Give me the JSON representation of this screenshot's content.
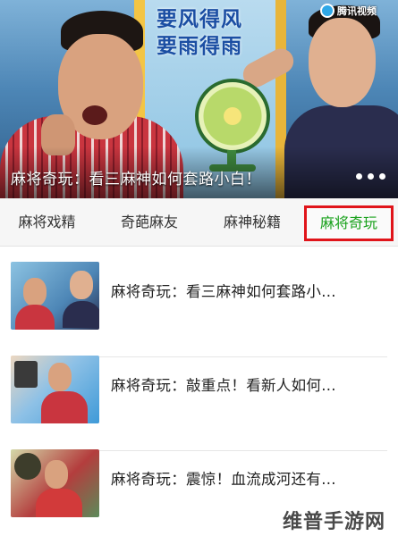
{
  "banner": {
    "slogan_line1": "要风得风",
    "slogan_line2": "要雨得雨",
    "brand_logo_text": "腾讯视频",
    "caption": "麻将奇玩：看三麻神如何套路小白！",
    "pager_dots": 3
  },
  "tabs": [
    {
      "label": "麻将戏精",
      "selected": false
    },
    {
      "label": "奇葩麻友",
      "selected": false
    },
    {
      "label": "麻神秘籍",
      "selected": false
    },
    {
      "label": "麻将奇玩",
      "selected": true
    }
  ],
  "list": [
    {
      "title": "麻将奇玩：看三麻神如何套路小..."
    },
    {
      "title": "麻将奇玩：敲重点！看新人如何..."
    },
    {
      "title": "麻将奇玩：震惊！血流成河还有..."
    }
  ],
  "watermark": "维普手游网",
  "colors": {
    "selected_tab_text": "#19a11c",
    "highlight_border": "#e0141a",
    "tab_bar_bg": "#f6f6f6"
  }
}
